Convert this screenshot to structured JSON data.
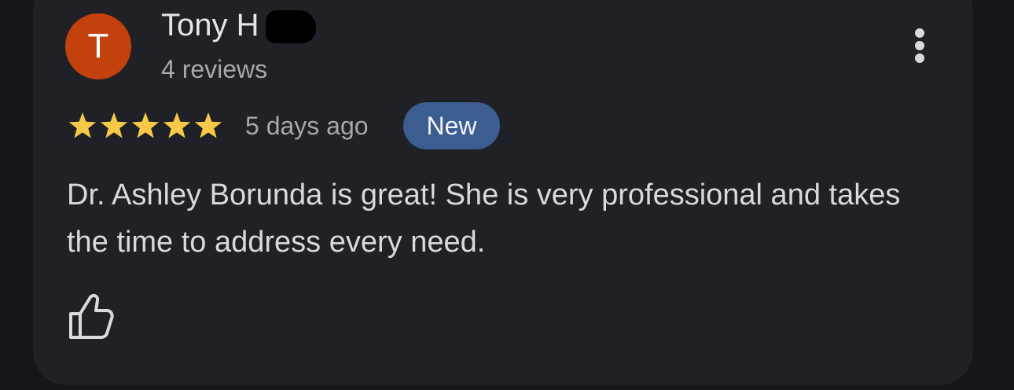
{
  "review": {
    "avatar_initial": "T",
    "reviewer_name": "Tony H",
    "review_count": "4 reviews",
    "rating": 5,
    "rating_max": 5,
    "time_ago": "5 days ago",
    "badge": "New",
    "text": "Dr. Ashley Borunda is great! She is very professional and takes the time to address every need."
  },
  "icons": {
    "menu": "more-vertical-icon",
    "star": "star-icon",
    "like": "thumbs-up-icon"
  },
  "colors": {
    "background": "#151619",
    "card": "#202126",
    "avatar": "#c2410c",
    "star": "#f7c948",
    "badge": "#3b5d8f"
  }
}
